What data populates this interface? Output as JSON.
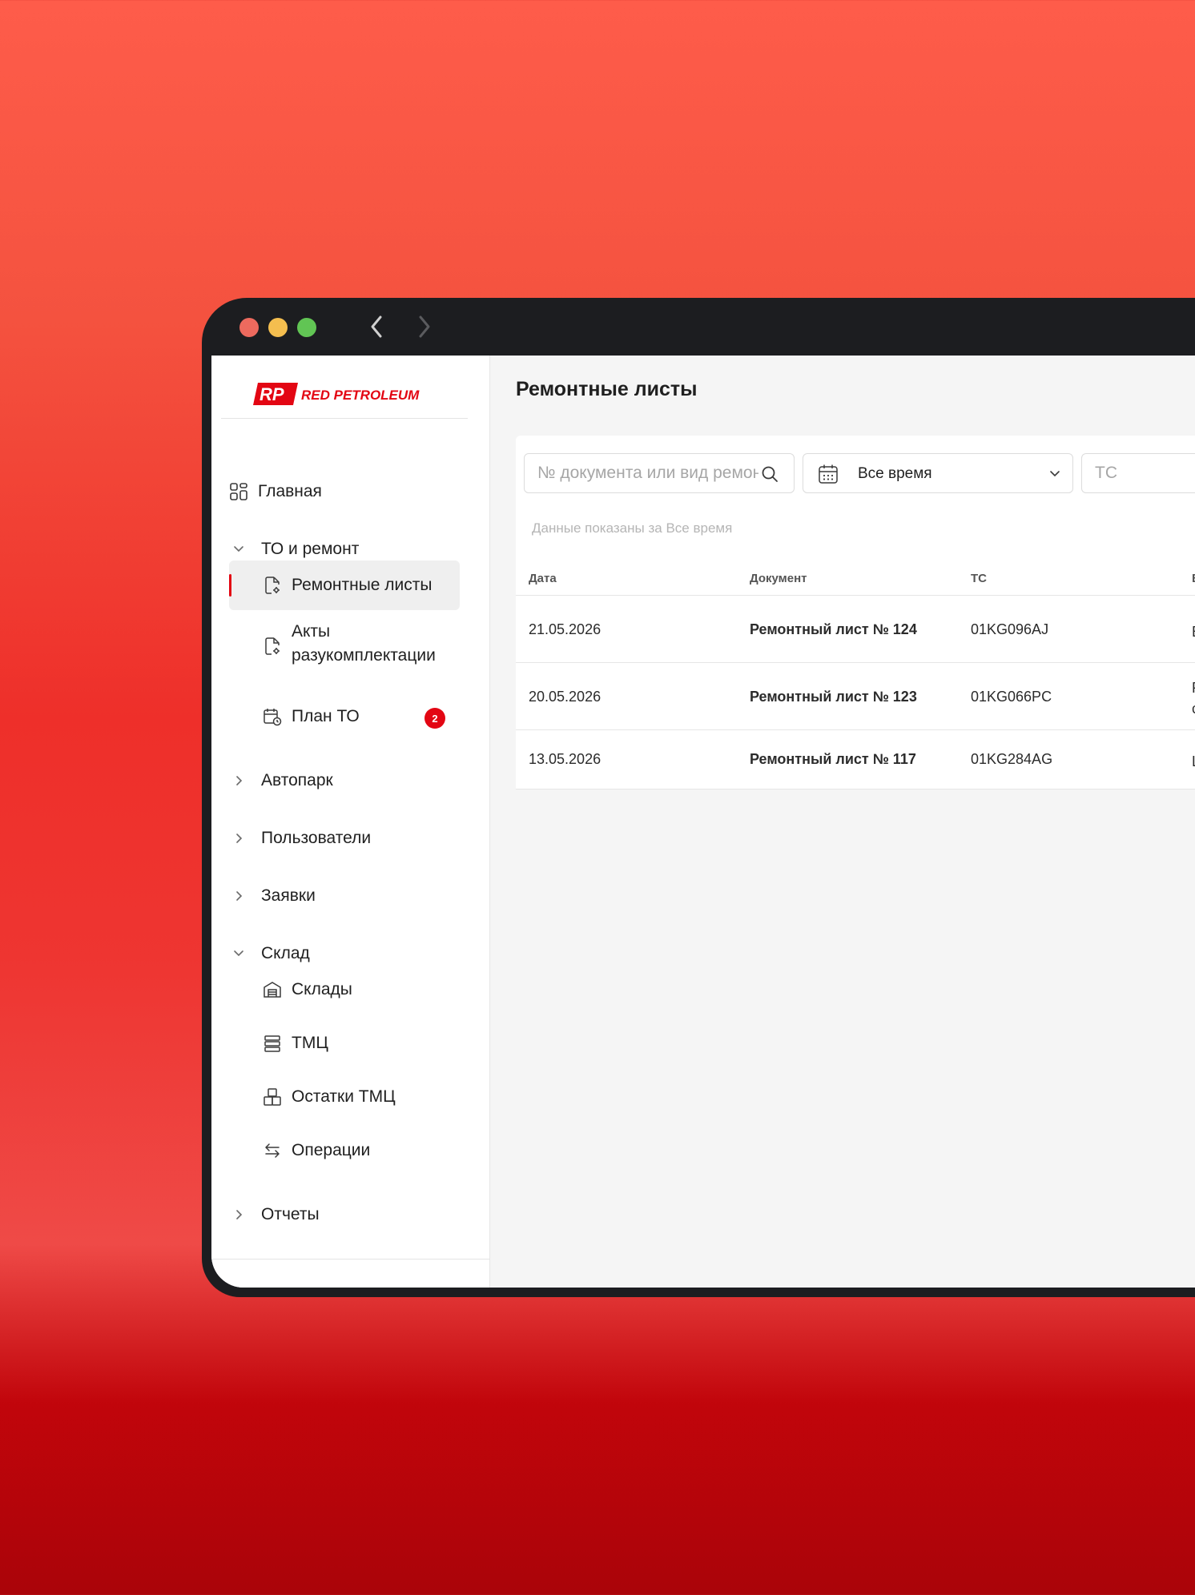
{
  "window": {
    "nav_back_label": "Назад",
    "nav_forward_label": "Вперед"
  },
  "brand": {
    "logo_mark": "RP",
    "logo_text": "RED PETROLEUM",
    "accent_color": "#e30613"
  },
  "sidebar": {
    "home": "Главная",
    "to_group": "ТО и ремонт",
    "to_items": [
      {
        "label": "Ремонтные листы",
        "icon": "document-gear-icon",
        "active": true
      },
      {
        "label": "Акты разукомплектации",
        "icon": "document-gear-icon"
      },
      {
        "label": "План ТО",
        "icon": "calendar-clock-icon",
        "badge": "2"
      }
    ],
    "fleet": "Автопарк",
    "users": "Пользователи",
    "requests": "Заявки",
    "warehouse_group": "Склад",
    "warehouse_items": [
      {
        "label": "Склады",
        "icon": "warehouse-icon"
      },
      {
        "label": "ТМЦ",
        "icon": "stack-icon"
      },
      {
        "label": "Остатки ТМЦ",
        "icon": "boxes-icon"
      },
      {
        "label": "Операции",
        "icon": "arrows-exchange-icon"
      }
    ],
    "reports": "Отчеты"
  },
  "main": {
    "title": "Ремонтные листы",
    "filters": {
      "search_placeholder": "№ документа или вид ремонта",
      "period_value": "Все время",
      "ts_placeholder": "ТС"
    },
    "hint_prefix": "Данные показаны за",
    "hint_value": "Все время",
    "table": {
      "columns": [
        "Дата",
        "Документ",
        "ТС",
        "В"
      ],
      "rows": [
        {
          "date": "21.05.2026",
          "doc": "Ремонтный лист № 124",
          "ts": "01KG096AJ",
          "extra": "Е"
        },
        {
          "date": "20.05.2026",
          "doc": "Ремонтный лист № 123",
          "ts": "01KG066PC",
          "extra": "Р\nс"
        },
        {
          "date": "13.05.2026",
          "doc": "Ремонтный лист № 117",
          "ts": "01KG284AG",
          "extra": "L"
        }
      ]
    }
  }
}
